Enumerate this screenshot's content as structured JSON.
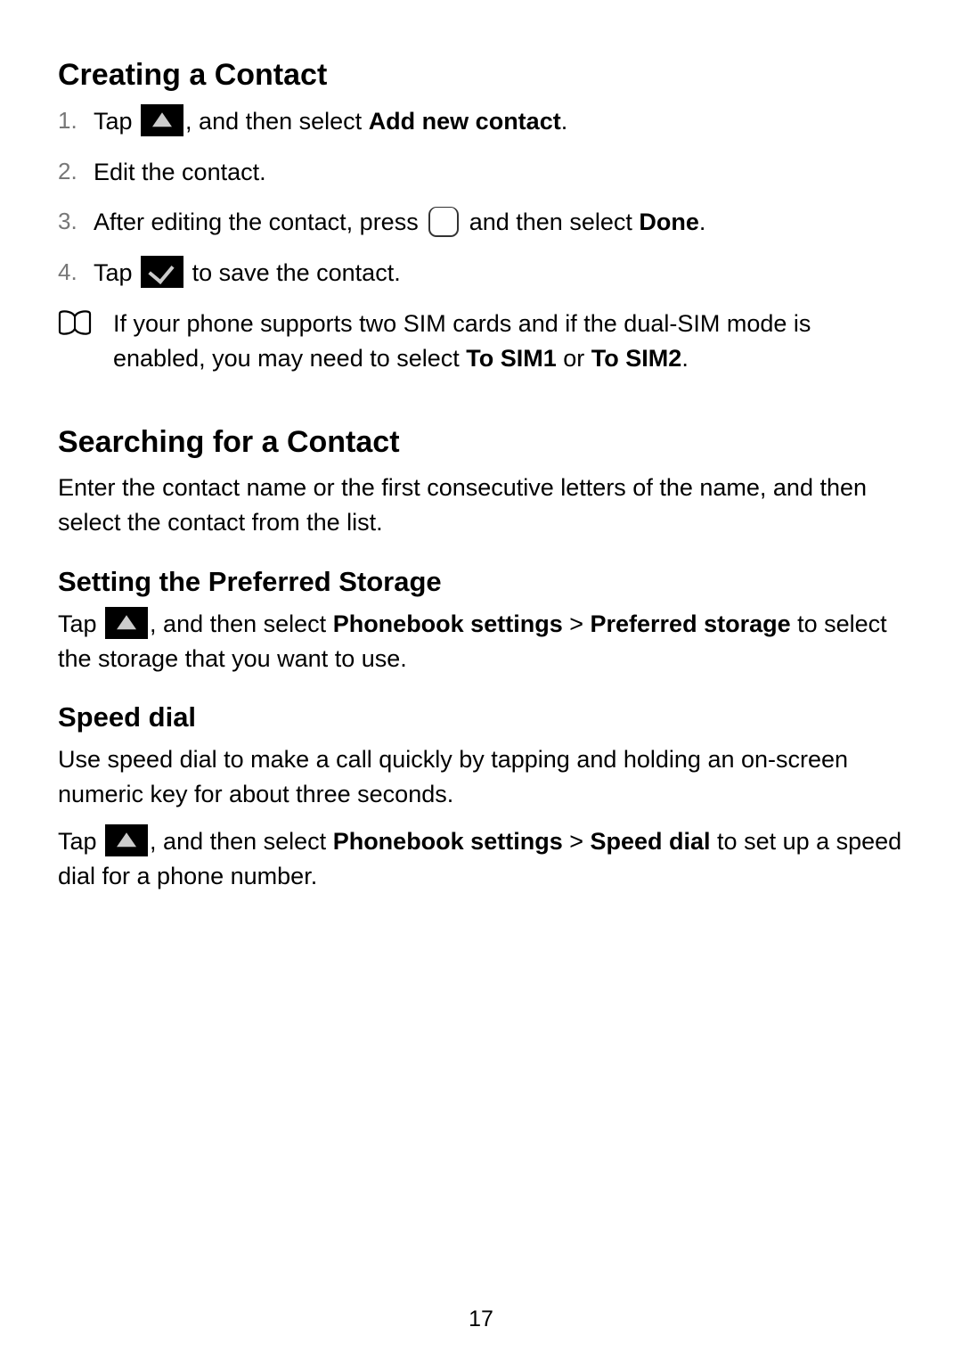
{
  "page_number": "17",
  "sections": {
    "creating": {
      "title": "Creating a Contact",
      "steps": [
        {
          "pre": "Tap ",
          "icon": "menu-triangle",
          "mid": ", and then select ",
          "bold": "Add new contact",
          "post": "."
        },
        {
          "text": "Edit the contact."
        },
        {
          "pre": "After editing the contact, press ",
          "icon": "softkey",
          "mid": " and then select ",
          "bold": "Done",
          "post": "."
        },
        {
          "pre": "Tap ",
          "icon": "check",
          "post": " to save the contact."
        }
      ],
      "note": {
        "pre": "If your phone supports two SIM cards and if the dual-SIM mode is enabled, you may need to select ",
        "bold1": "To SIM1",
        "mid": " or ",
        "bold2": "To SIM2",
        "post": "."
      }
    },
    "searching": {
      "title": "Searching for a Contact",
      "body": "Enter the contact name or the first consecutive letters of the name, and then select the contact from the list."
    },
    "storage": {
      "title": "Setting the Preferred Storage",
      "pre": "Tap ",
      "icon": "menu-triangle",
      "mid": ", and then select ",
      "bold1": "Phonebook settings",
      "gt": " > ",
      "bold2": "Preferred storage",
      "post": " to select the storage that you want to use."
    },
    "speed": {
      "title": "Speed dial",
      "intro": "Use speed dial to make a call quickly by tapping and holding an on-screen numeric key for about three seconds.",
      "pre": "Tap ",
      "icon": "menu-triangle",
      "mid": ", and then select ",
      "bold1": "Phonebook settings",
      "gt": " > ",
      "bold2": "Speed dial",
      "post": " to set up a speed dial for a phone number."
    }
  }
}
